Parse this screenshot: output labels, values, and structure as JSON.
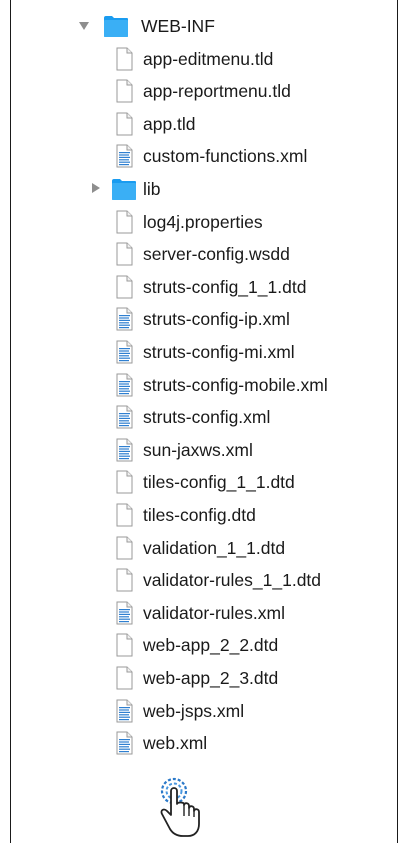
{
  "tree": [
    {
      "name": "WEB-INF",
      "kind": "folder",
      "expanded": true,
      "depth": 0,
      "icon": "folder-icon"
    },
    {
      "name": "app-editmenu.tld",
      "kind": "file",
      "depth": 1,
      "icon": "blank-document-icon"
    },
    {
      "name": "app-reportmenu.tld",
      "kind": "file",
      "depth": 1,
      "icon": "blank-document-icon"
    },
    {
      "name": "app.tld",
      "kind": "file",
      "depth": 1,
      "icon": "blank-document-icon"
    },
    {
      "name": "custom-functions.xml",
      "kind": "file",
      "depth": 1,
      "icon": "text-document-icon"
    },
    {
      "name": "lib",
      "kind": "folder",
      "expanded": false,
      "depth": 1,
      "icon": "folder-icon"
    },
    {
      "name": "log4j.properties",
      "kind": "file",
      "depth": 1,
      "icon": "blank-document-icon"
    },
    {
      "name": "server-config.wsdd",
      "kind": "file",
      "depth": 1,
      "icon": "blank-document-icon"
    },
    {
      "name": "struts-config_1_1.dtd",
      "kind": "file",
      "depth": 1,
      "icon": "blank-document-icon"
    },
    {
      "name": "struts-config-ip.xml",
      "kind": "file",
      "depth": 1,
      "icon": "text-document-icon"
    },
    {
      "name": "struts-config-mi.xml",
      "kind": "file",
      "depth": 1,
      "icon": "text-document-icon"
    },
    {
      "name": "struts-config-mobile.xml",
      "kind": "file",
      "depth": 1,
      "icon": "text-document-icon"
    },
    {
      "name": "struts-config.xml",
      "kind": "file",
      "depth": 1,
      "icon": "text-document-icon"
    },
    {
      "name": "sun-jaxws.xml",
      "kind": "file",
      "depth": 1,
      "icon": "text-document-icon"
    },
    {
      "name": "tiles-config_1_1.dtd",
      "kind": "file",
      "depth": 1,
      "icon": "blank-document-icon"
    },
    {
      "name": "tiles-config.dtd",
      "kind": "file",
      "depth": 1,
      "icon": "blank-document-icon"
    },
    {
      "name": "validation_1_1.dtd",
      "kind": "file",
      "depth": 1,
      "icon": "blank-document-icon"
    },
    {
      "name": "validator-rules_1_1.dtd",
      "kind": "file",
      "depth": 1,
      "icon": "blank-document-icon"
    },
    {
      "name": "validator-rules.xml",
      "kind": "file",
      "depth": 1,
      "icon": "text-document-icon"
    },
    {
      "name": "web-app_2_2.dtd",
      "kind": "file",
      "depth": 1,
      "icon": "blank-document-icon"
    },
    {
      "name": "web-app_2_3.dtd",
      "kind": "file",
      "depth": 1,
      "icon": "blank-document-icon"
    },
    {
      "name": "web-jsps.xml",
      "kind": "file",
      "depth": 1,
      "icon": "text-document-icon"
    },
    {
      "name": "web.xml",
      "kind": "file",
      "depth": 1,
      "icon": "text-document-icon"
    }
  ],
  "cursor": {
    "icon": "pointing-hand-click-icon"
  },
  "colors": {
    "folder": "#1a9cf0",
    "text": "#1a1a1a",
    "disclosure": "#8e8e8e",
    "doc_lines": "#2f7fd0"
  }
}
